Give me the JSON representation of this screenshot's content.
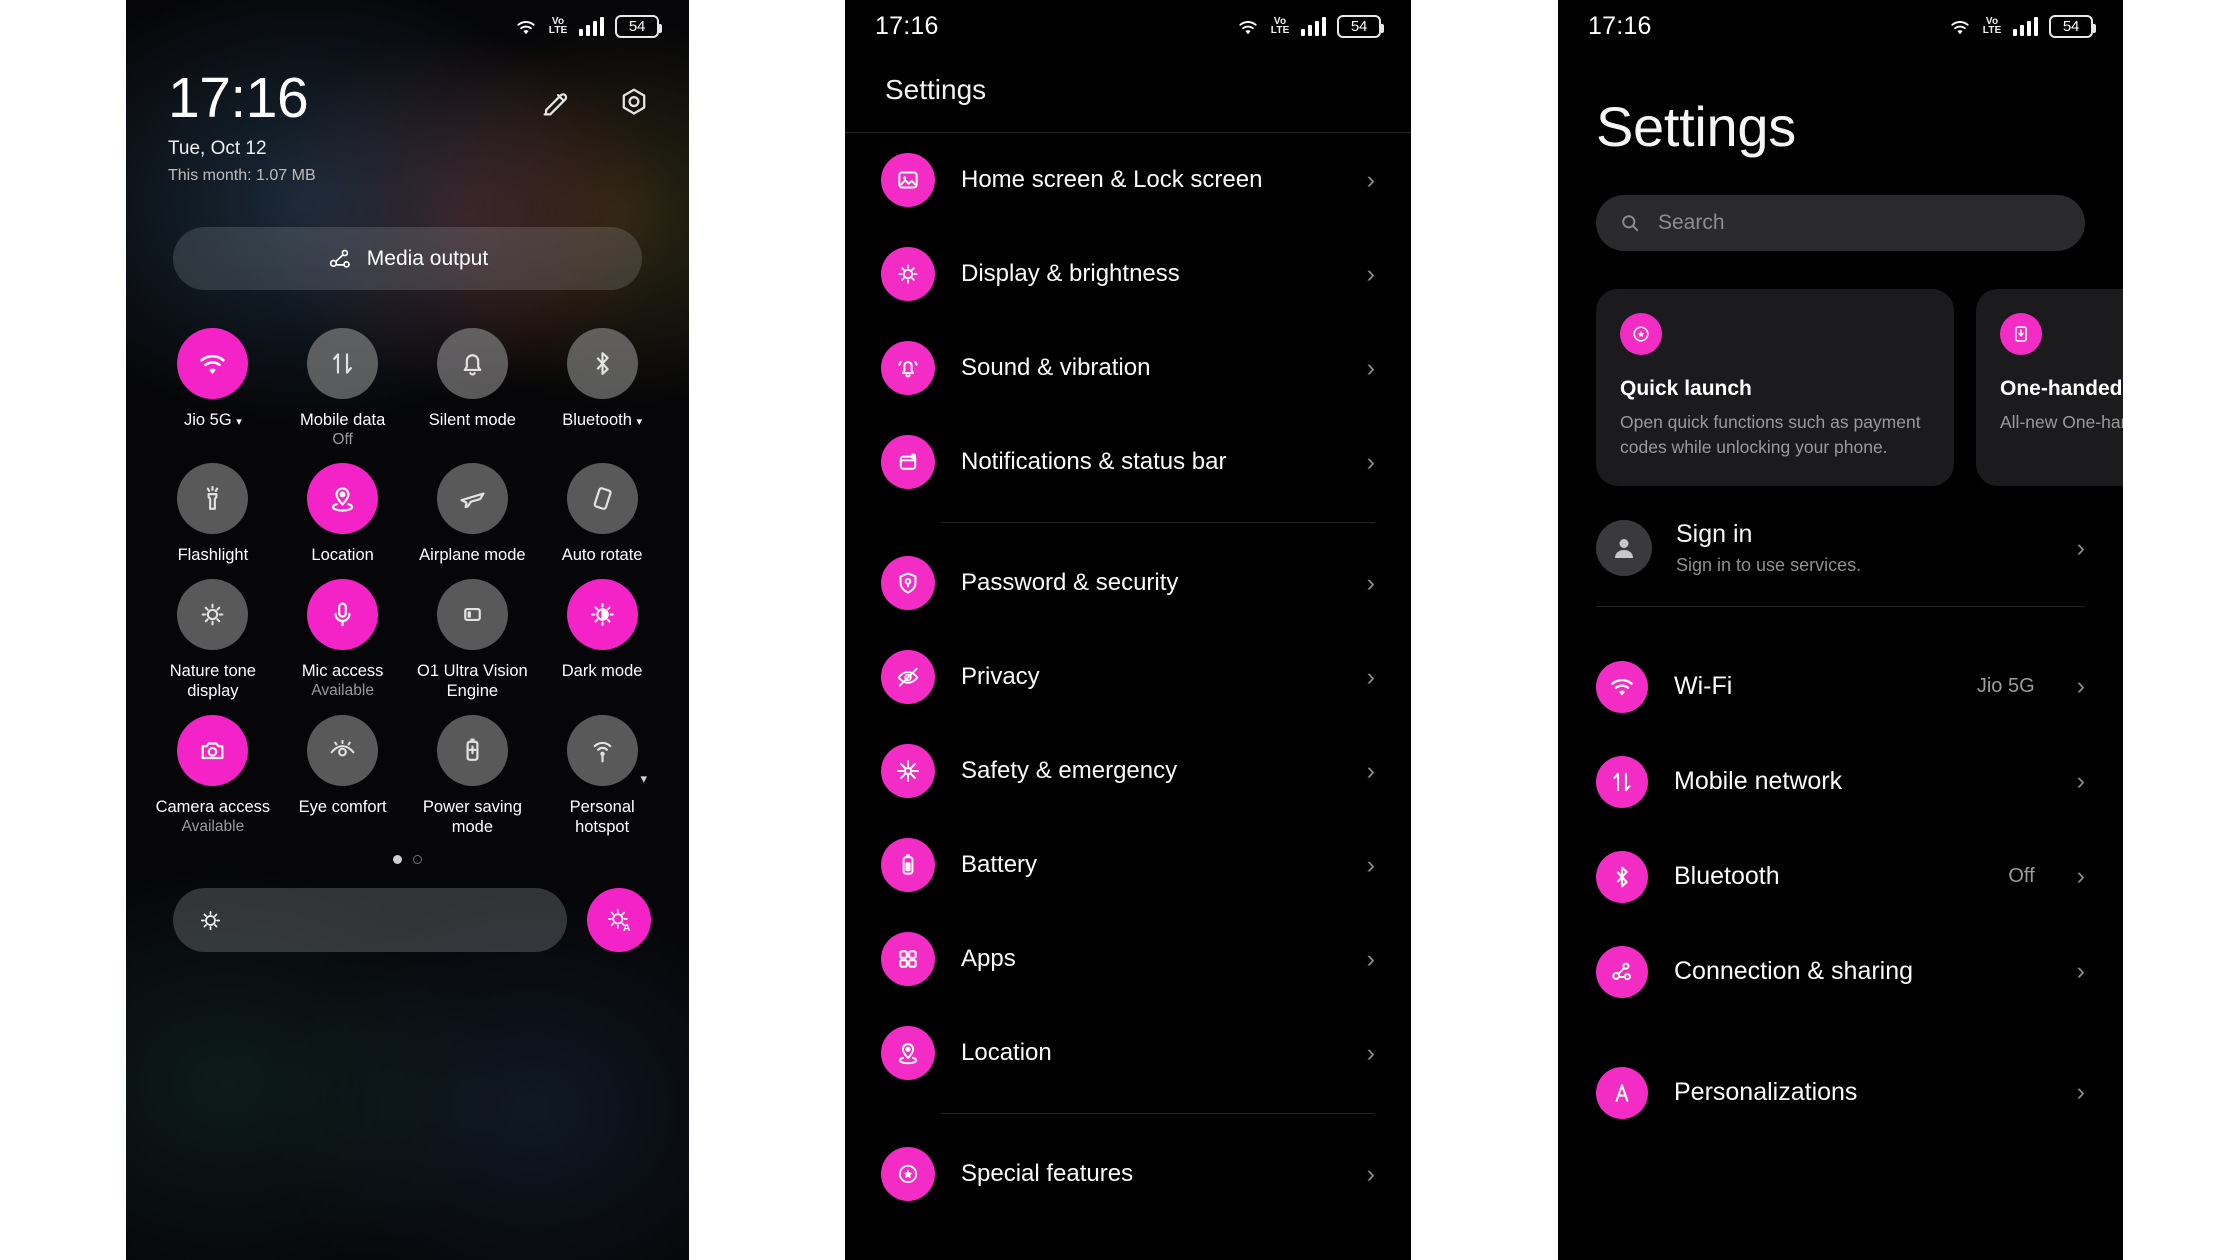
{
  "status_bar": {
    "time": "17:16",
    "volte_top": "Vo",
    "volte_bottom": "LTE",
    "battery": "54",
    "icons": [
      "wifi-icon",
      "volte-icon",
      "signal-bars-icon",
      "battery-icon"
    ]
  },
  "quick_settings": {
    "clock": "17:16",
    "date": "Tue, Oct 12",
    "data_usage": "This month: 1.07 MB",
    "header_icons": [
      {
        "name": "edit-icon",
        "label": "Edit"
      },
      {
        "name": "settings-gear-icon",
        "label": "Settings"
      }
    ],
    "media_output_label": "Media output",
    "tiles": [
      {
        "label": "Jio 5G",
        "sub": "",
        "on": true,
        "icon": "wifi-icon",
        "caret": true
      },
      {
        "label": "Mobile data",
        "sub": "Off",
        "on": false,
        "icon": "data-transfer-icon",
        "caret": false
      },
      {
        "label": "Silent mode",
        "sub": "",
        "on": false,
        "icon": "bell-icon",
        "caret": false
      },
      {
        "label": "Bluetooth",
        "sub": "",
        "on": false,
        "icon": "bluetooth-icon",
        "caret": true
      },
      {
        "label": "Flashlight",
        "sub": "",
        "on": false,
        "icon": "flashlight-icon",
        "caret": false
      },
      {
        "label": "Location",
        "sub": "",
        "on": true,
        "icon": "location-pin-icon",
        "caret": false
      },
      {
        "label": "Airplane mode",
        "sub": "",
        "on": false,
        "icon": "airplane-icon",
        "caret": false
      },
      {
        "label": "Auto rotate",
        "sub": "",
        "on": false,
        "icon": "rotate-icon",
        "caret": false
      },
      {
        "label": "Nature tone display",
        "sub": "",
        "on": false,
        "icon": "nature-tone-icon",
        "caret": false
      },
      {
        "label": "Mic access",
        "sub": "Available",
        "on": true,
        "icon": "microphone-icon",
        "caret": false
      },
      {
        "label": "O1 Ultra Vision Engine",
        "sub": "",
        "on": false,
        "icon": "ultra-vision-icon",
        "caret": false
      },
      {
        "label": "Dark mode",
        "sub": "",
        "on": true,
        "icon": "dark-mode-icon",
        "caret": false
      },
      {
        "label": "Camera access",
        "sub": "Available",
        "on": true,
        "icon": "camera-icon",
        "caret": false
      },
      {
        "label": "Eye comfort",
        "sub": "",
        "on": false,
        "icon": "eye-comfort-icon",
        "caret": false
      },
      {
        "label": "Power saving mode",
        "sub": "",
        "on": false,
        "icon": "battery-saver-icon",
        "caret": false
      },
      {
        "label": "Personal hotspot",
        "sub": "",
        "on": false,
        "icon": "hotspot-icon",
        "caret": false
      }
    ],
    "page_dots": [
      true,
      false
    ],
    "brightness": {
      "icon": "brightness-icon",
      "auto_label": "A",
      "auto_icon": "auto-brightness-icon"
    }
  },
  "settings_list": {
    "title": "Settings",
    "groups": [
      {
        "items": [
          {
            "label": "Home screen & Lock screen",
            "icon": "image-icon"
          },
          {
            "label": "Display & brightness",
            "icon": "brightness-icon"
          },
          {
            "label": "Sound & vibration",
            "icon": "bell-ring-icon"
          },
          {
            "label": "Notifications & status bar",
            "icon": "notification-icon"
          }
        ]
      },
      {
        "items": [
          {
            "label": "Password & security",
            "icon": "shield-lock-icon"
          },
          {
            "label": "Privacy",
            "icon": "privacy-eye-icon"
          },
          {
            "label": "Safety & emergency",
            "icon": "sos-icon"
          },
          {
            "label": "Battery",
            "icon": "battery-icon"
          },
          {
            "label": "Apps",
            "icon": "apps-grid-icon"
          },
          {
            "label": "Location",
            "icon": "location-pin-icon"
          }
        ]
      },
      {
        "items": [
          {
            "label": "Special features",
            "icon": "star-badge-icon"
          }
        ]
      }
    ]
  },
  "settings_home": {
    "title": "Settings",
    "search_placeholder": "Search",
    "cards": [
      {
        "title": "Quick launch",
        "desc": "Open quick functions such as payment codes while unlocking your phone.",
        "icon": "quick-launch-icon"
      },
      {
        "title": "One-handed mode",
        "desc": "All-new One-handed mode",
        "icon": "one-handed-icon"
      }
    ],
    "sign_in": {
      "title": "Sign in",
      "subtitle": "Sign in to use services.",
      "avatar_icon": "person-icon"
    },
    "items": [
      {
        "label": "Wi-Fi",
        "value": "Jio 5G",
        "icon": "wifi-icon"
      },
      {
        "label": "Mobile network",
        "value": "",
        "icon": "data-transfer-icon"
      },
      {
        "label": "Bluetooth",
        "value": "Off",
        "icon": "bluetooth-icon"
      },
      {
        "label": "Connection & sharing",
        "value": "",
        "icon": "connection-share-icon"
      },
      {
        "label": "Personalizations",
        "value": "",
        "icon": "personalization-icon"
      }
    ]
  },
  "colors": {
    "accent": "#f423c8",
    "accent_list": "#f22cc5",
    "background": "#000000",
    "card": "#1b1b1d",
    "text_primary": "#fafafa",
    "text_secondary": "#9a9a9a"
  }
}
